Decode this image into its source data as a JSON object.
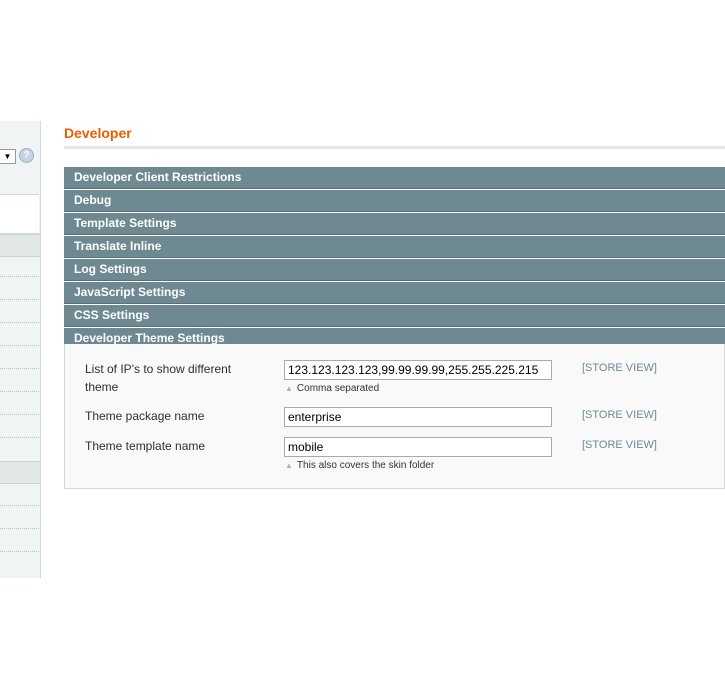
{
  "page": {
    "title": "Developer"
  },
  "sidebar": {
    "scope_select_glyph": "▼"
  },
  "sections": [
    {
      "label": "Developer Client Restrictions"
    },
    {
      "label": "Debug"
    },
    {
      "label": "Template Settings"
    },
    {
      "label": "Translate Inline"
    },
    {
      "label": "Log Settings"
    },
    {
      "label": "JavaScript Settings"
    },
    {
      "label": "CSS Settings"
    },
    {
      "label": "Developer Theme Settings"
    }
  ],
  "theme_settings": {
    "ip_list": {
      "label_line1": "List of IP's to show different",
      "label_line2": "theme",
      "value": "123.123.123.123,99.99.99.99,255.255.225.215",
      "note": "Comma separated",
      "scope": "[STORE VIEW]"
    },
    "package_name": {
      "label": "Theme package name",
      "value": "enterprise",
      "scope": "[STORE VIEW]"
    },
    "template_name": {
      "label": "Theme template name",
      "value": "mobile",
      "note": "This also covers the skin folder",
      "scope": "[STORE VIEW]"
    }
  },
  "colors": {
    "title_orange": "#eb5e00",
    "section_header": "#6f8992",
    "scope_text": "#6f8992"
  }
}
